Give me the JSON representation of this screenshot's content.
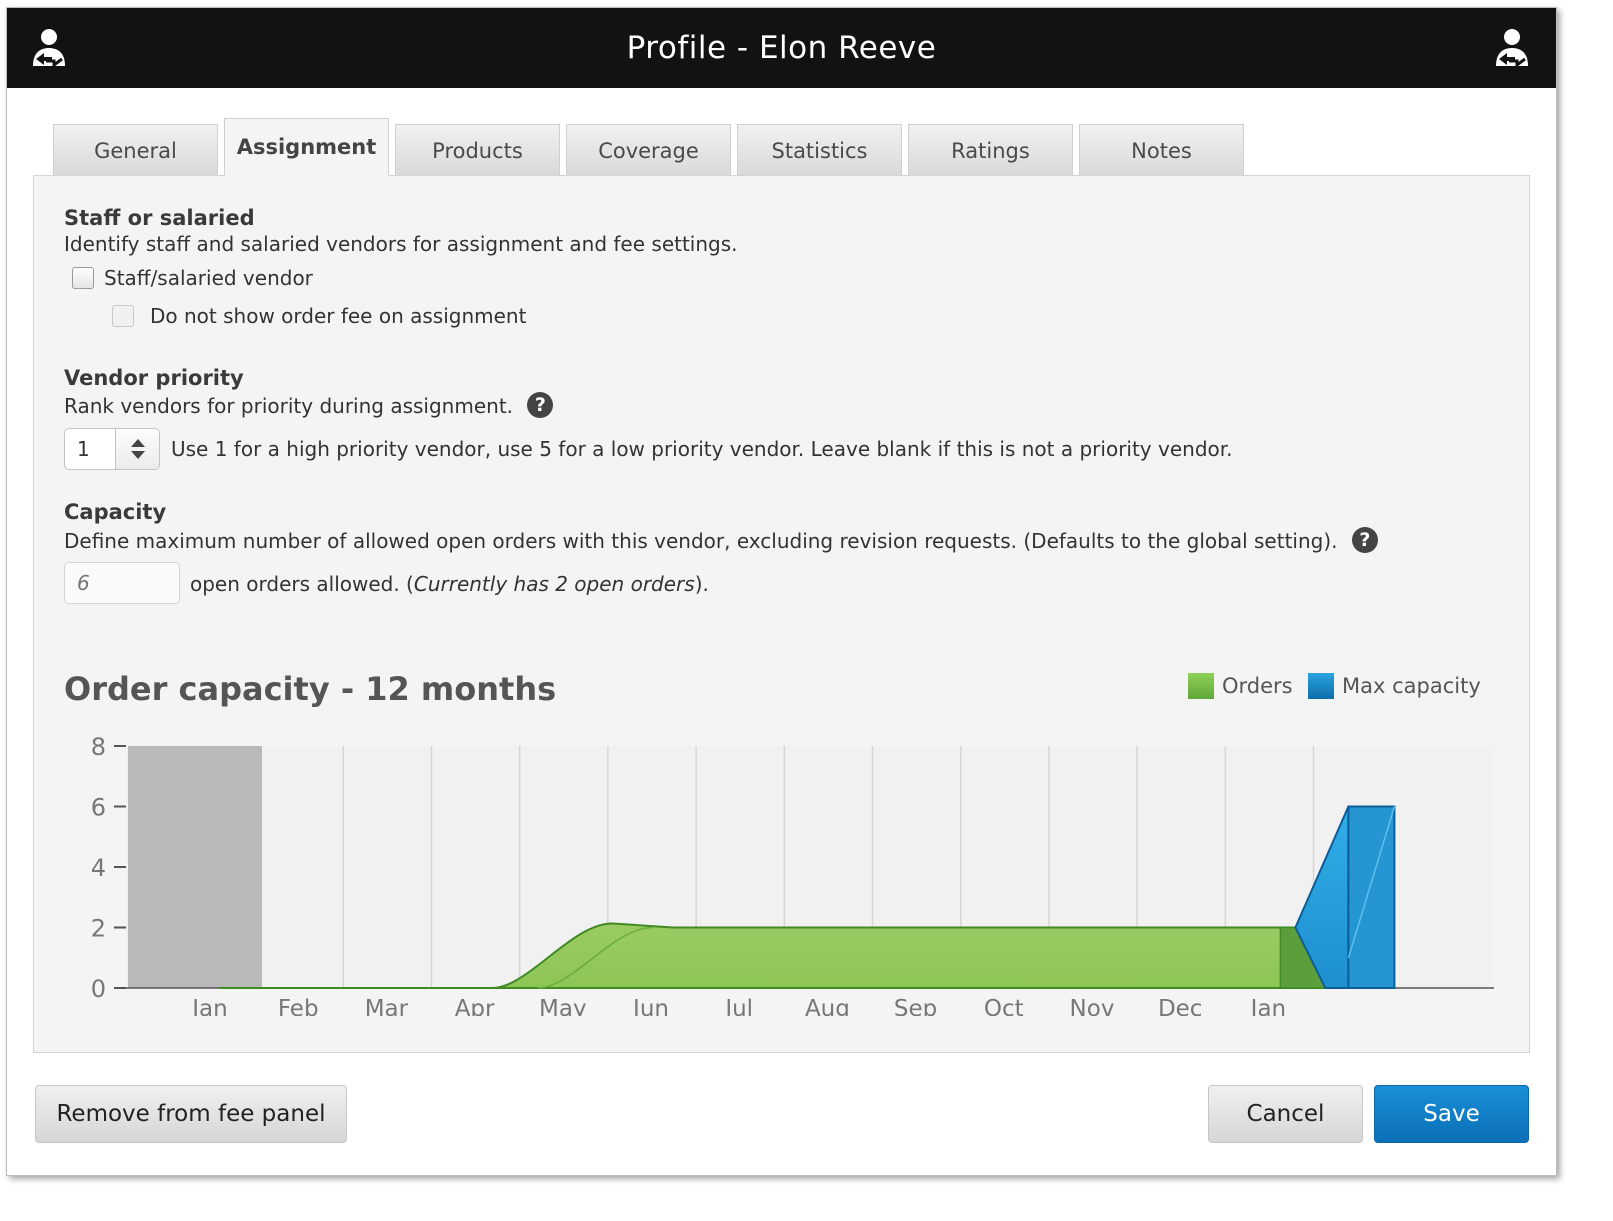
{
  "window": {
    "title": "Profile - Elon Reeve",
    "left_icon": "user-switch-icon",
    "right_icon": "user-switch-icon"
  },
  "tabs": [
    {
      "label": "General",
      "active": false
    },
    {
      "label": "Assignment",
      "active": true
    },
    {
      "label": "Products",
      "active": false
    },
    {
      "label": "Coverage",
      "active": false
    },
    {
      "label": "Statistics",
      "active": false
    },
    {
      "label": "Ratings",
      "active": false
    },
    {
      "label": "Notes",
      "active": false
    }
  ],
  "staff": {
    "title": "Staff or salaried",
    "description": "Identify staff and salaried vendors for assignment and fee settings.",
    "checkbox_label": "Staff/salaried vendor",
    "checked": false,
    "sub_checkbox_label": "Do not show order fee on assignment",
    "sub_checked": false,
    "sub_disabled": true
  },
  "priority": {
    "title": "Vendor priority",
    "description": "Rank vendors for priority during assignment.",
    "help_icon": "question-icon",
    "value": "1",
    "hint": "Use 1 for a high priority vendor, use 5 for a low priority vendor. Leave blank if this is not a priority vendor."
  },
  "capacity": {
    "title": "Capacity",
    "description": "Define maximum number of allowed open orders with this vendor, excluding revision requests. (Defaults to the global setting).",
    "help_icon": "question-icon",
    "placeholder": "6",
    "suffix_before": "open orders allowed. (",
    "current_note": "Currently has 2 open orders",
    "suffix_after": ")."
  },
  "chart_data": {
    "type": "area",
    "title": "Order capacity - 12 months",
    "legend": [
      {
        "name": "Orders",
        "color": "#7cc245"
      },
      {
        "name": "Max capacity",
        "color": "#2aa3e0"
      }
    ],
    "legend_position": "top-right",
    "x_labels": [
      "Jan",
      "Feb",
      "Mar",
      "Apr",
      "May",
      "Jun",
      "Jul",
      "Aug",
      "Sep",
      "Oct",
      "Nov",
      "Dec",
      "Jan"
    ],
    "y_ticks": [
      0,
      2,
      4,
      6,
      8
    ],
    "ylim": [
      0,
      8
    ],
    "grid": true,
    "past_shade": {
      "from": "Jan",
      "value": 8,
      "color": "#b9b9b9"
    },
    "series": [
      {
        "name": "Orders",
        "values": [
          0,
          0,
          0,
          0,
          2,
          2,
          2,
          2,
          2,
          2,
          2,
          2,
          2
        ]
      },
      {
        "name": "Max capacity",
        "values": [
          null,
          null,
          null,
          null,
          null,
          null,
          null,
          null,
          null,
          null,
          null,
          null,
          6
        ]
      }
    ]
  },
  "buttons": {
    "remove": "Remove from fee panel",
    "cancel": "Cancel",
    "save": "Save"
  }
}
